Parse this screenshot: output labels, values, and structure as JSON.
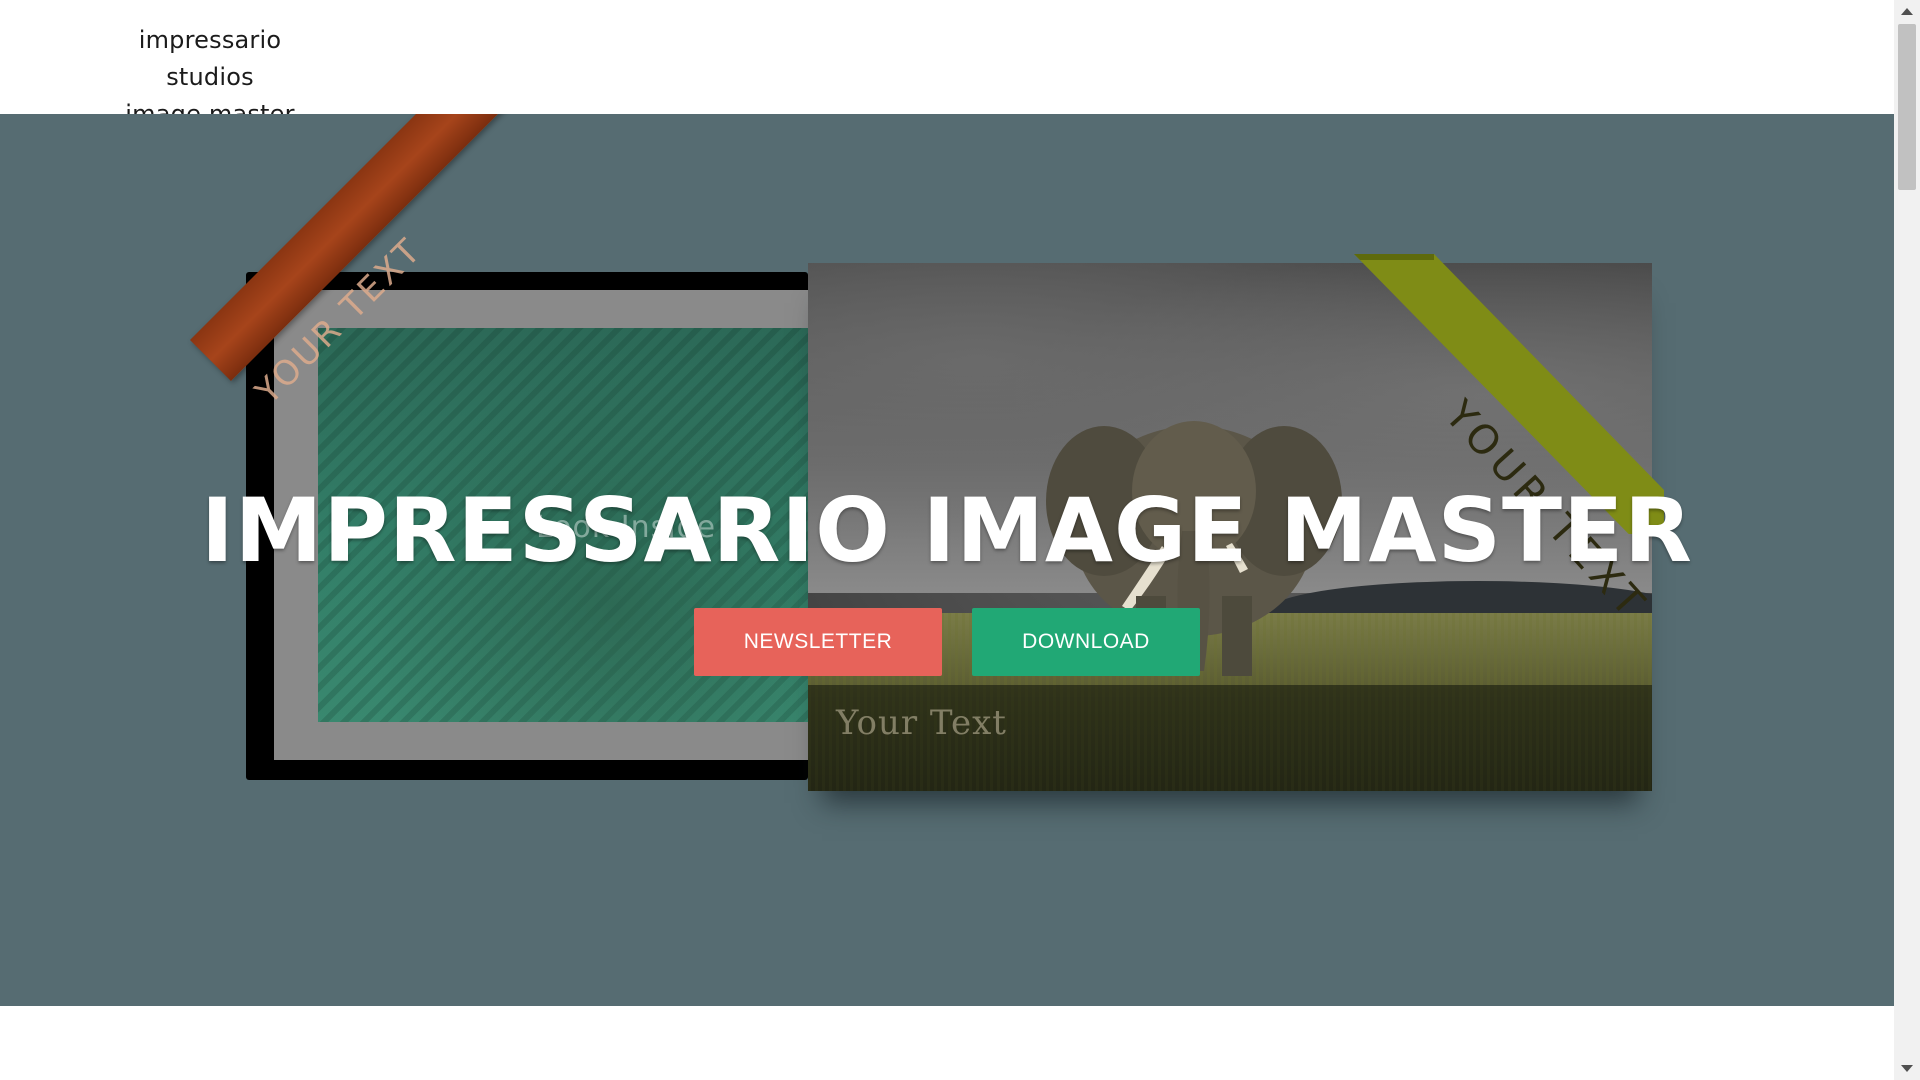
{
  "header": {
    "brand_line1": "impressario studios",
    "brand_line2": "image master"
  },
  "hero": {
    "background_color": "#566c72",
    "headline": "IMPRESSARIO IMAGE MASTER",
    "left_ribbon_text": "YOUR TEXT",
    "look_inside_text": "Look Inside",
    "right_ribbon_text": "YOUR TEXT",
    "caption_text": "Your Text",
    "buttons": {
      "newsletter_label": "NEWSLETTER",
      "newsletter_color": "#e7635a",
      "download_label": "DOWNLOAD",
      "download_color": "#21a875"
    }
  },
  "scrollbar": {
    "up_icon": "arrow-up-icon",
    "down_icon": "arrow-down-icon"
  }
}
